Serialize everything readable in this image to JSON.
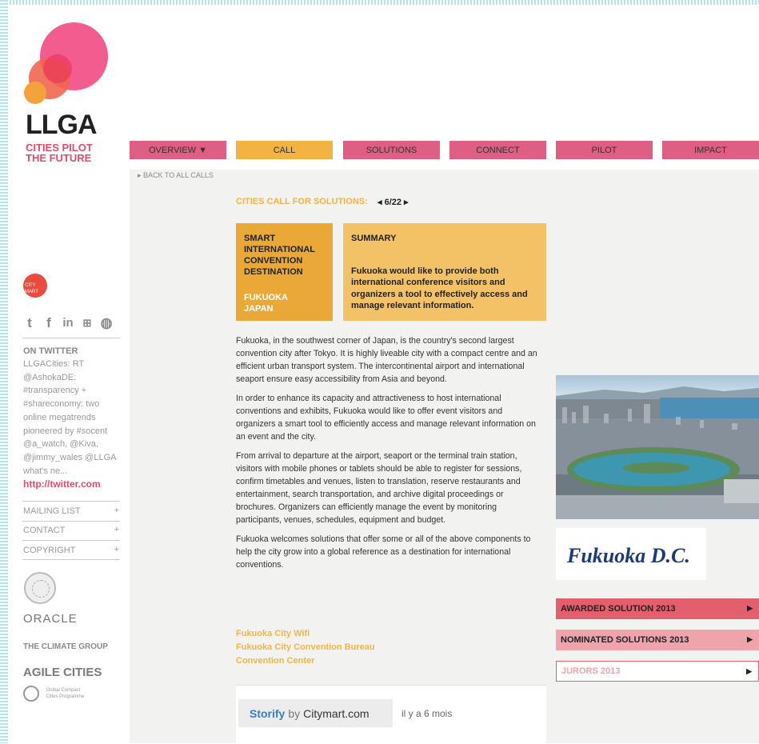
{
  "brand": {
    "logo_text": "LLGA",
    "tagline_line1": "CITIES PILOT",
    "tagline_line2": "THE FUTURE",
    "citymart_label": "CITY MART"
  },
  "nav": {
    "items": [
      {
        "label": "OVERVIEW ▼"
      },
      {
        "label": "CALL"
      },
      {
        "label": "SOLUTIONS"
      },
      {
        "label": "CONNECT"
      },
      {
        "label": "PILOT"
      },
      {
        "label": "IMPACT"
      }
    ]
  },
  "sidebar": {
    "back_link": "▸ BACK TO ALL CALLS",
    "twitter_heading": "ON TWITTER",
    "tweet_lines": [
      "LLGACities: RT",
      "@AshokaDE:",
      "#transparency +",
      "#shareconomy: two",
      "online megatrends",
      "pioneered by #socent",
      "@a_watch, @Kiva,",
      "@jimmy_wales @LLGA",
      "what's ne..."
    ],
    "tweet_link": "http://twitter.com",
    "links": [
      {
        "label": "MAILING LIST",
        "icon": "+"
      },
      {
        "label": "CONTACT",
        "icon": "+"
      },
      {
        "label": "COPYRIGHT",
        "icon": "+"
      }
    ],
    "sponsors": {
      "oracle": "ORACLE",
      "climate_group": "THE CLIMATE GROUP",
      "agile_cities": "AGILE CITIES",
      "global_compact_line1": "Global Compact",
      "global_compact_line2": "Cities Programme"
    }
  },
  "call": {
    "heading": "CITIES CALL FOR SOLUTIONS:",
    "pager": "◂ 6/22 ▸",
    "title_lines": [
      "SMART",
      "INTERNATIONAL",
      "CONVENTION",
      "DESTINATION"
    ],
    "city": "FUKUOKA",
    "country": "JAPAN",
    "summary_label": "SUMMARY",
    "summary_text": "Fukuoka would like to provide both international conference visitors and organizers a tool to effectively access and manage relevant information.",
    "paragraphs": [
      "Fukuoka, in the southwest corner of Japan, is the country's second largest convention city after Tokyo. It is highly liveable city with a compact centre and an efficient urban transport system. The intercontinental airport and international seaport ensure easy accessibility from Asia and beyond.",
      "In order to enhance its capacity and attractiveness to host international conventions and exhibits, Fukuoka would like to offer event visitors and organizers a smart tool to efficiently access and manage relevant information on an event and the city.",
      "From arrival to departure at the airport, seaport or the terminal train station, visitors with mobile phones or tablets should be able to register for sessions, confirm timetables and venues, listen to translation, reserve restaurants and entertainment, search transportation, and archive digital proceedings or brochures. Organizers can efficiently manage the event by monitoring participants, venues, schedules, equipment and budget.",
      "Fukuoka welcomes solutions that offer some or all of the above components to help the city grow into a global reference as a destination for international conventions."
    ],
    "related_links": [
      "Fukuoka City Wifi",
      "Fukuoka City Convention Bureau",
      "Convention Center"
    ]
  },
  "storify": {
    "brand": "Storify",
    "by": "by",
    "partner": "Citymart.com",
    "ago": "il y a 6 mois"
  },
  "right": {
    "partner_logo": "Fukuoka D.C.",
    "awards": [
      {
        "label": "AWARDED SOLUTION 2013",
        "bg": "#e35f6e",
        "color": "#222"
      },
      {
        "label": "NOMINATED SOLUTIONS 2013",
        "bg": "#efa3ab",
        "color": "#222"
      },
      {
        "label": "JURORS 2013",
        "bg": "#ffffff",
        "color": "#f0a1ad"
      }
    ]
  },
  "colors": {
    "pink": "#df5e84",
    "orange": "#f3b340",
    "brand_pink": "#e34b6b"
  }
}
